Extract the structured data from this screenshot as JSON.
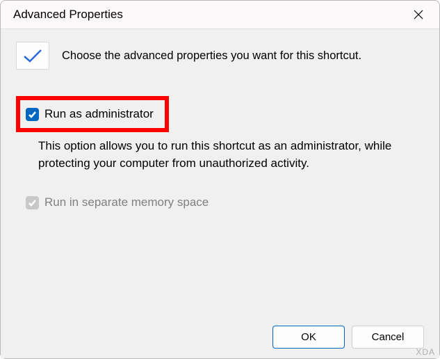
{
  "titlebar": {
    "title": "Advanced Properties"
  },
  "header": {
    "text": "Choose the advanced properties you want for this shortcut."
  },
  "options": {
    "run_as_admin": {
      "label": "Run as administrator",
      "checked": true,
      "description": "This option allows you to run this shortcut as an administrator, while protecting your computer from unauthorized activity."
    },
    "separate_memory": {
      "label": "Run in separate memory space",
      "checked": true,
      "disabled": true
    }
  },
  "buttons": {
    "ok": "OK",
    "cancel": "Cancel"
  },
  "watermark": "XDA"
}
